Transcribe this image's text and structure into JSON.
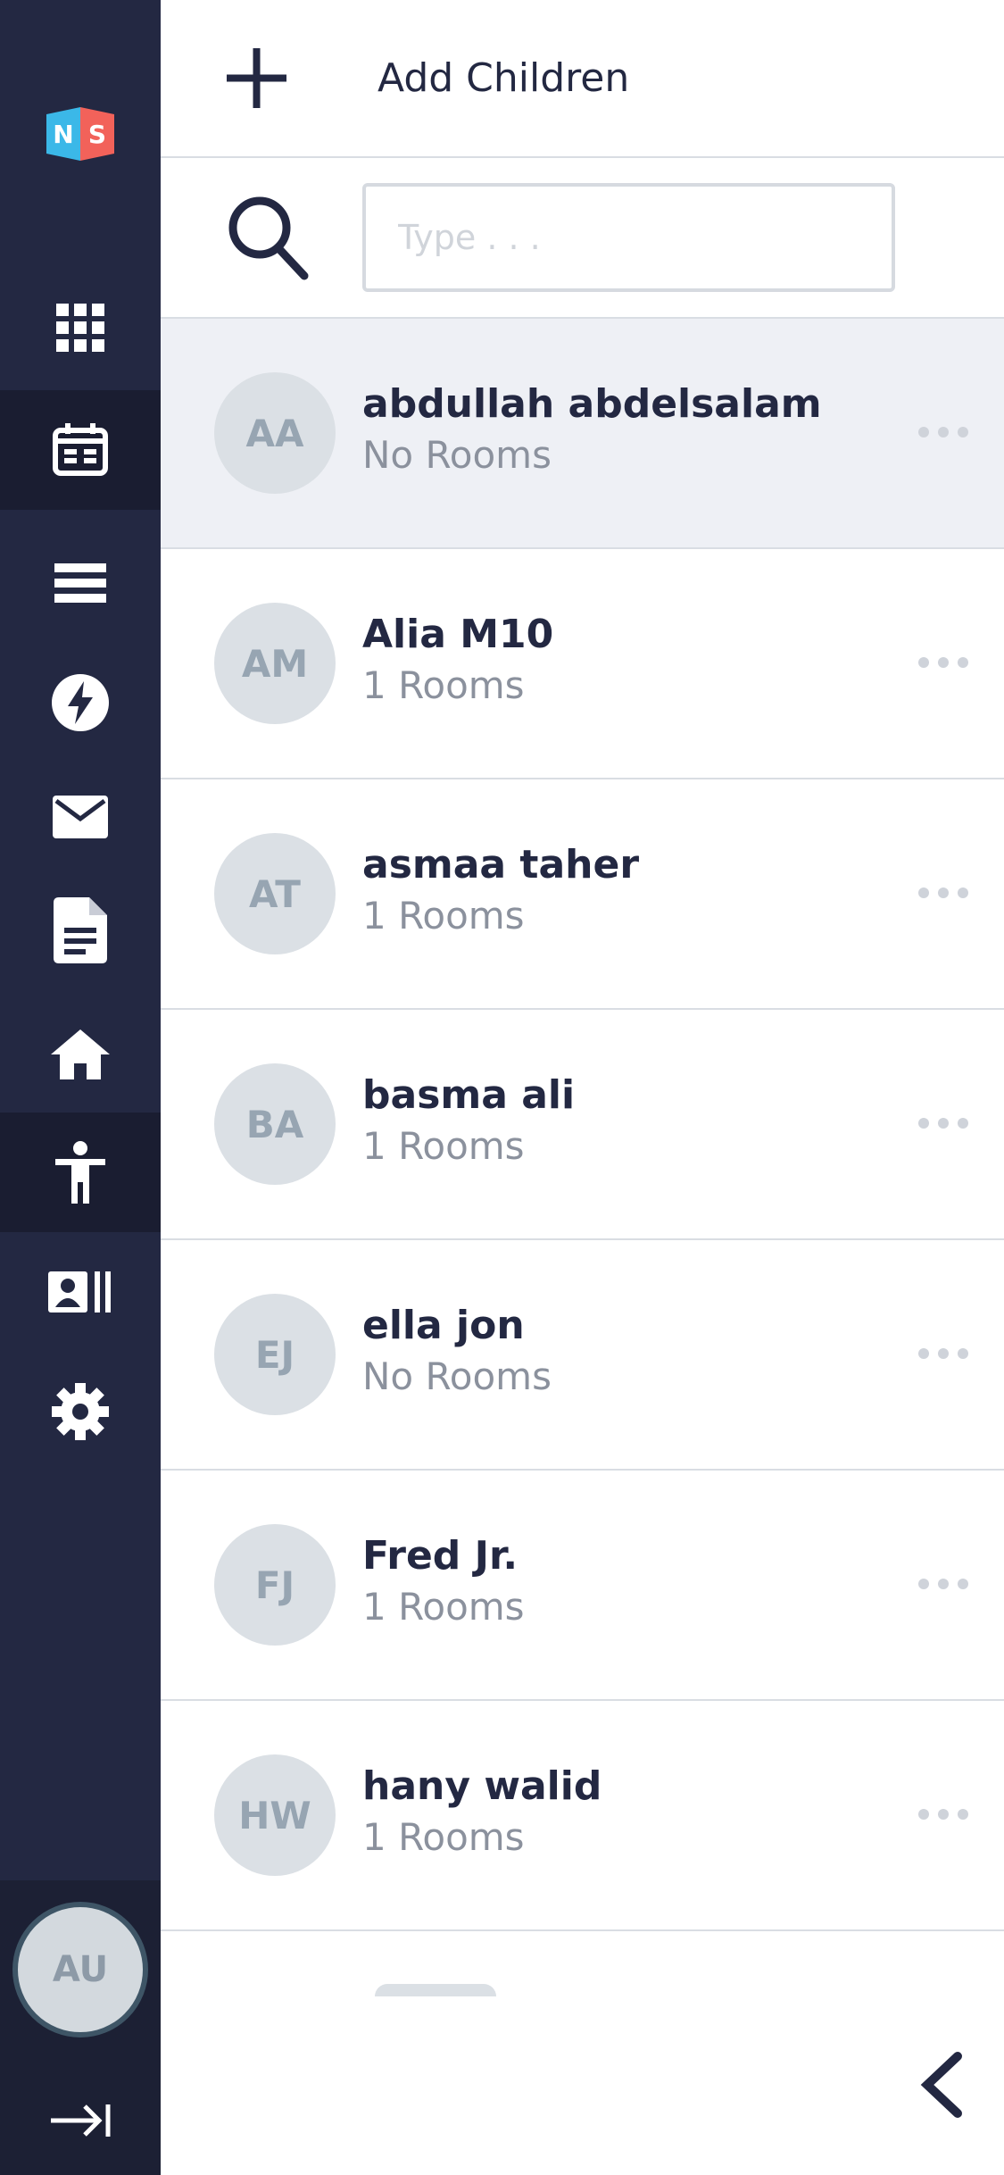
{
  "app": {
    "logo_letters": [
      "N",
      "S"
    ],
    "logo_colors": {
      "left": "#3bb8e8",
      "right": "#f2625a"
    }
  },
  "sidebar": {
    "items": [
      {
        "name": "dashboard",
        "icon": "grid-icon",
        "active": false
      },
      {
        "name": "calendar",
        "icon": "calendar-icon",
        "active": true
      },
      {
        "name": "list",
        "icon": "list-icon",
        "active": false
      },
      {
        "name": "activity",
        "icon": "lightning-icon",
        "active": false
      },
      {
        "name": "messages",
        "icon": "mail-icon",
        "active": false
      },
      {
        "name": "documents",
        "icon": "document-icon",
        "active": false
      },
      {
        "name": "home",
        "icon": "home-icon",
        "active": false
      },
      {
        "name": "children",
        "icon": "child-icon",
        "active": true
      },
      {
        "name": "contacts",
        "icon": "contact-card-icon",
        "active": false
      },
      {
        "name": "settings",
        "icon": "gear-icon",
        "active": false
      }
    ],
    "user_initials": "AU",
    "collapse_icon": "arrow-right-bar-icon"
  },
  "header": {
    "add_icon": "plus-icon",
    "title": "Add Children"
  },
  "search": {
    "icon": "search-icon",
    "placeholder": "Type . . .",
    "value": ""
  },
  "children": [
    {
      "initials": "AA",
      "name": "abdullah abdelsalam",
      "rooms": "No Rooms",
      "highlight": true
    },
    {
      "initials": "AM",
      "name": "Alia M10",
      "rooms": "1 Rooms",
      "highlight": false
    },
    {
      "initials": "AT",
      "name": "asmaa taher",
      "rooms": "1 Rooms",
      "highlight": false
    },
    {
      "initials": "BA",
      "name": "basma ali",
      "rooms": "1 Rooms",
      "highlight": false
    },
    {
      "initials": "EJ",
      "name": "ella jon",
      "rooms": "No Rooms",
      "highlight": false
    },
    {
      "initials": "FJ",
      "name": "Fred Jr.",
      "rooms": "1 Rooms",
      "highlight": false
    },
    {
      "initials": "HW",
      "name": "hany walid",
      "rooms": "1 Rooms",
      "highlight": false
    }
  ],
  "footer": {
    "back_icon": "chevron-left-icon"
  },
  "colors": {
    "sidebar_bg": "#232842",
    "sidebar_active": "#1a1d31",
    "text_dark": "#232842",
    "text_muted": "#8b919d",
    "divider": "#d9dde3",
    "highlight_row": "#eef0f5"
  }
}
